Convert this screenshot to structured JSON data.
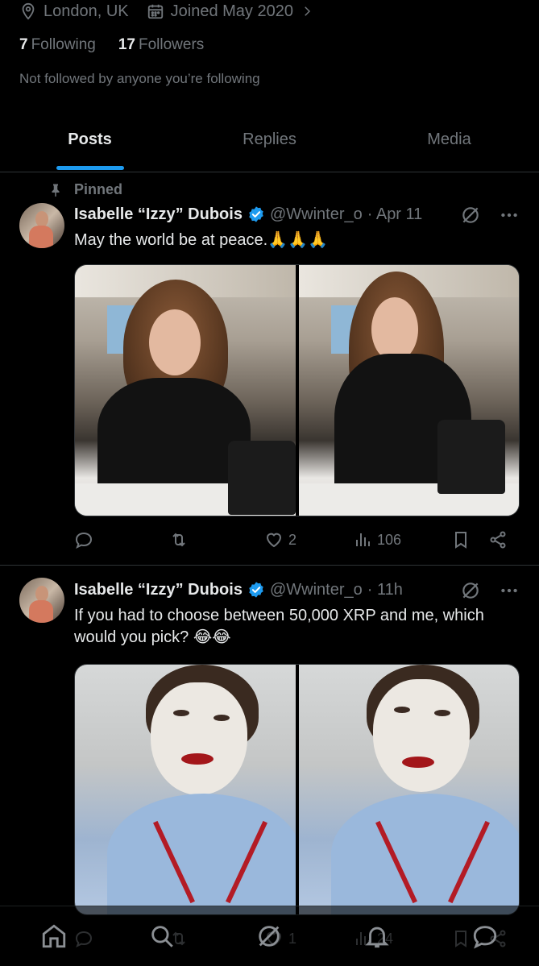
{
  "profile": {
    "location": "London, UK",
    "joined": "Joined May 2020",
    "following_count": "7",
    "following_label": "Following",
    "followers_count": "17",
    "followers_label": "Followers",
    "not_followed": "Not followed by anyone you’re following"
  },
  "tabs": [
    {
      "label": "Posts",
      "active": true
    },
    {
      "label": "Replies",
      "active": false
    },
    {
      "label": "Media",
      "active": false
    }
  ],
  "posts": [
    {
      "pinned_label": "Pinned",
      "name": "Isabelle “Izzy” Dubois",
      "handle": "@Wwinter_o",
      "time": "· Apr 11",
      "text": "May the world be at peace.🙏🙏🙏",
      "likes": "2",
      "views": "106"
    },
    {
      "name": "Isabelle “Izzy” Dubois",
      "handle": "@Wwinter_o",
      "time": "· 11h",
      "text": "If you had to choose between 50,000 XRP and me, which would you pick? 😂😂",
      "likes": "1",
      "views": "24"
    }
  ],
  "colors": {
    "accent": "#1d9bf0",
    "muted": "#71767b",
    "text": "#e7e9ea",
    "divider": "#2f3336",
    "background": "#000000"
  },
  "icons": {
    "location": "location-pin-icon",
    "calendar": "calendar-icon",
    "pin": "pin-icon",
    "verified": "verified-badge-icon",
    "grok": "grok-icon",
    "more": "more-dots-icon",
    "reply": "reply-icon",
    "retweet": "retweet-icon",
    "like": "heart-icon",
    "views": "views-icon",
    "bookmark": "bookmark-icon",
    "share": "share-icon",
    "home": "home-icon",
    "search": "search-icon",
    "notifications": "bell-icon",
    "messages": "messages-icon"
  }
}
